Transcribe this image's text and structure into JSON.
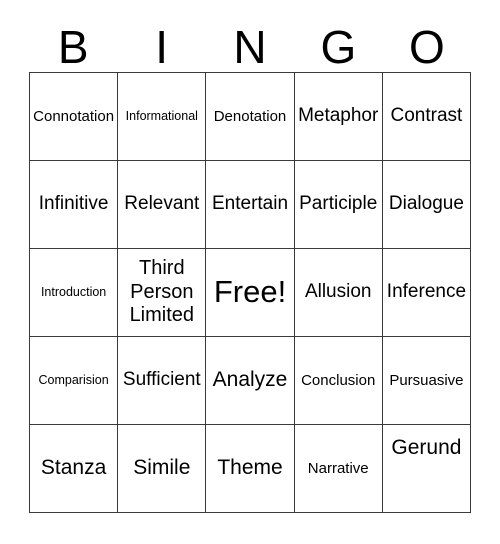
{
  "card": {
    "title": "BINGO",
    "header_letters": [
      "B",
      "I",
      "N",
      "G",
      "O"
    ],
    "free_space": "Free!",
    "colors": {
      "background": "#ffffff",
      "border": "#3a3a3a",
      "text": "#000000"
    },
    "grid": {
      "rows": 5,
      "columns": 5
    },
    "rows": [
      [
        {
          "label": "Connotation",
          "size": "sm"
        },
        {
          "label": "Informational",
          "size": "xs"
        },
        {
          "label": "Denotation",
          "size": "sm"
        },
        {
          "label": "Metaphor",
          "size": "md"
        },
        {
          "label": "Contrast",
          "size": "md"
        }
      ],
      [
        {
          "label": "Infinitive",
          "size": "md"
        },
        {
          "label": "Relevant",
          "size": "md"
        },
        {
          "label": "Entertain",
          "size": "md"
        },
        {
          "label": "Participle",
          "size": "md"
        },
        {
          "label": "Dialogue",
          "size": "md"
        }
      ],
      [
        {
          "label": "Introduction",
          "size": "xs"
        },
        {
          "label": "Third Person Limited",
          "size": "multiline"
        },
        {
          "label": "Free!",
          "size": "xl"
        },
        {
          "label": "Allusion",
          "size": "md"
        },
        {
          "label": "Inference",
          "size": "md"
        }
      ],
      [
        {
          "label": "Comparision",
          "size": "xs"
        },
        {
          "label": "Sufficient",
          "size": "md"
        },
        {
          "label": "Analyze",
          "size": "lg"
        },
        {
          "label": "Conclusion",
          "size": "sm"
        },
        {
          "label": "Pursuasive",
          "size": "sm"
        }
      ],
      [
        {
          "label": "Stanza",
          "size": "lg"
        },
        {
          "label": "Simile",
          "size": "lg"
        },
        {
          "label": "Theme",
          "size": "lg"
        },
        {
          "label": "Narrative",
          "size": "sm"
        },
        {
          "label": "Gerund",
          "size": "lg"
        }
      ]
    ]
  }
}
